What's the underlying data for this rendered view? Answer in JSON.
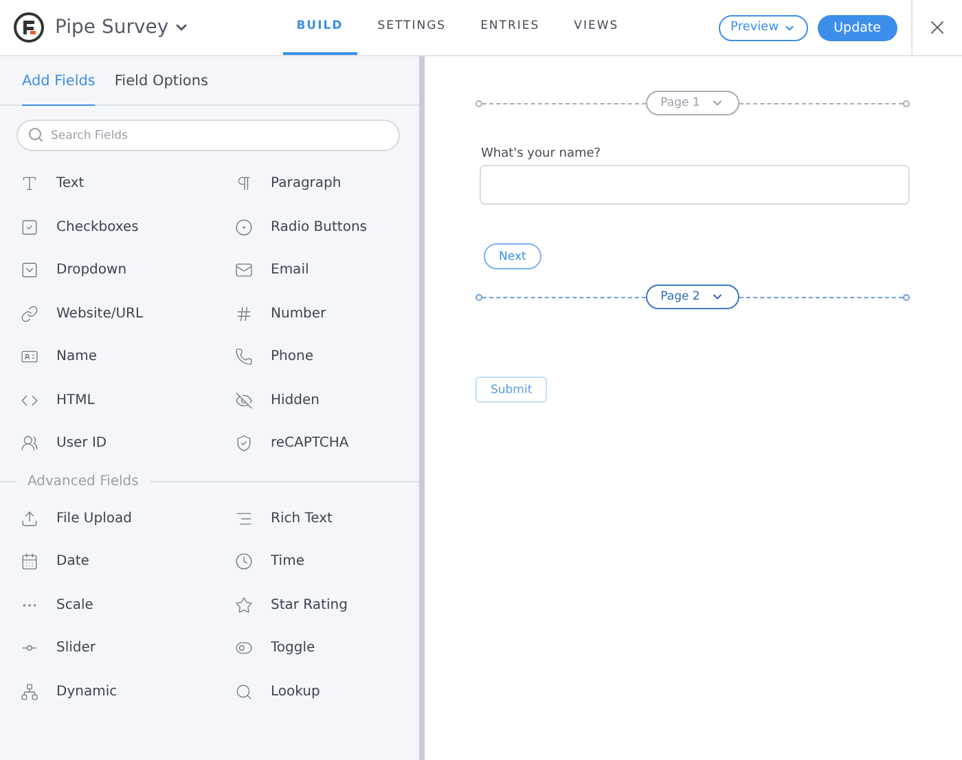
{
  "header": {
    "form_title": "Pipe Survey",
    "nav": [
      {
        "label": "BUILD",
        "selected": true
      },
      {
        "label": "SETTINGS",
        "selected": false
      },
      {
        "label": "ENTRIES",
        "selected": false
      },
      {
        "label": "VIEWS",
        "selected": false
      }
    ],
    "preview": "Preview",
    "update": "Update"
  },
  "sidebar": {
    "tabs": [
      {
        "label": "Add Fields",
        "selected": true
      },
      {
        "label": "Field Options",
        "selected": false
      }
    ],
    "search": {
      "placeholder": "Search Fields"
    },
    "fields": [
      "Text",
      "Paragraph",
      "Checkboxes",
      "Radio Buttons",
      "Dropdown",
      "Email",
      "Website/URL",
      "Number",
      "Name",
      "Phone",
      "HTML",
      "Hidden",
      "User ID",
      "reCAPTCHA"
    ],
    "advanced_title": "Advanced Fields",
    "advanced_fields": [
      "File Upload",
      "Rich Text",
      "Date",
      "Time",
      "Scale",
      "Star Rating",
      "Slider",
      "Toggle",
      "Dynamic",
      "Lookup"
    ]
  },
  "canvas": {
    "items": [
      {
        "kind": "page_break",
        "label": "Page 1",
        "selected": false
      },
      {
        "kind": "text_field",
        "label": "What's your name?"
      },
      {
        "kind": "next",
        "label": "Next"
      },
      {
        "kind": "page_break",
        "label": "Page 2",
        "selected": true
      },
      {
        "kind": "submit",
        "label": "Submit"
      }
    ]
  }
}
